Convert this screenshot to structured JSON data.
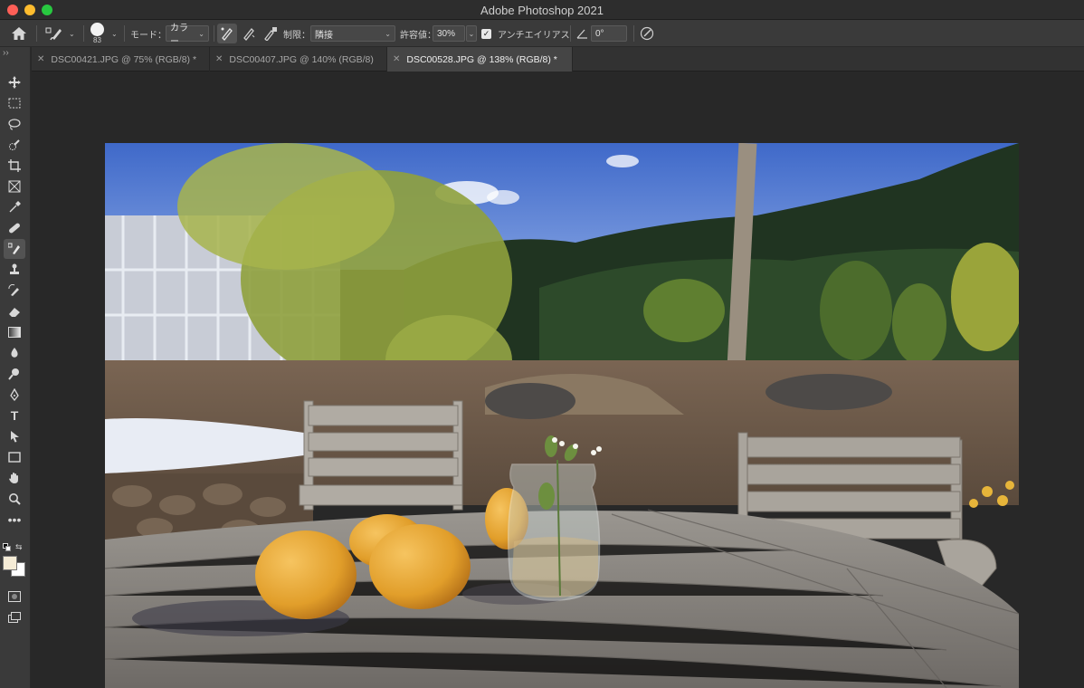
{
  "window": {
    "title": "Adobe Photoshop 2021"
  },
  "options_bar": {
    "brush_size": "83",
    "mode_label": "モード：",
    "mode_value": "カラー",
    "limit_label": "制限：",
    "limit_value": "隣接",
    "tolerance_label": "許容値：",
    "tolerance_value": "30%",
    "antialias_label": "アンチエイリアス",
    "antialias_checked": true,
    "angle_value": "0°"
  },
  "tabs": [
    {
      "label": "DSC00421.JPG @ 75% (RGB/8) *",
      "active": false
    },
    {
      "label": "DSC00407.JPG @ 140% (RGB/8)",
      "active": false
    },
    {
      "label": "DSC00528.JPG @ 138% (RGB/8) *",
      "active": true
    }
  ],
  "toolbar": {
    "tools": [
      "move-tool",
      "rectangular-marquee-tool",
      "lasso-tool",
      "quick-selection-tool",
      "crop-tool",
      "frame-tool",
      "eyedropper-tool",
      "healing-brush-tool",
      "color-replacement-tool",
      "clone-stamp-tool",
      "history-brush-tool",
      "eraser-tool",
      "gradient-tool",
      "blur-tool",
      "dodge-tool",
      "pen-tool",
      "type-tool",
      "path-selection-tool",
      "rectangle-tool",
      "hand-tool",
      "zoom-tool",
      "more-tools"
    ],
    "active_tool": "color-replacement-tool",
    "foreground_color": "#f5ecd6",
    "background_color": "#ffffff"
  },
  "colors": {
    "chrome_dark": "#2d2d2d",
    "panel": "#3a3a3a",
    "canvas_bg": "#282828"
  }
}
